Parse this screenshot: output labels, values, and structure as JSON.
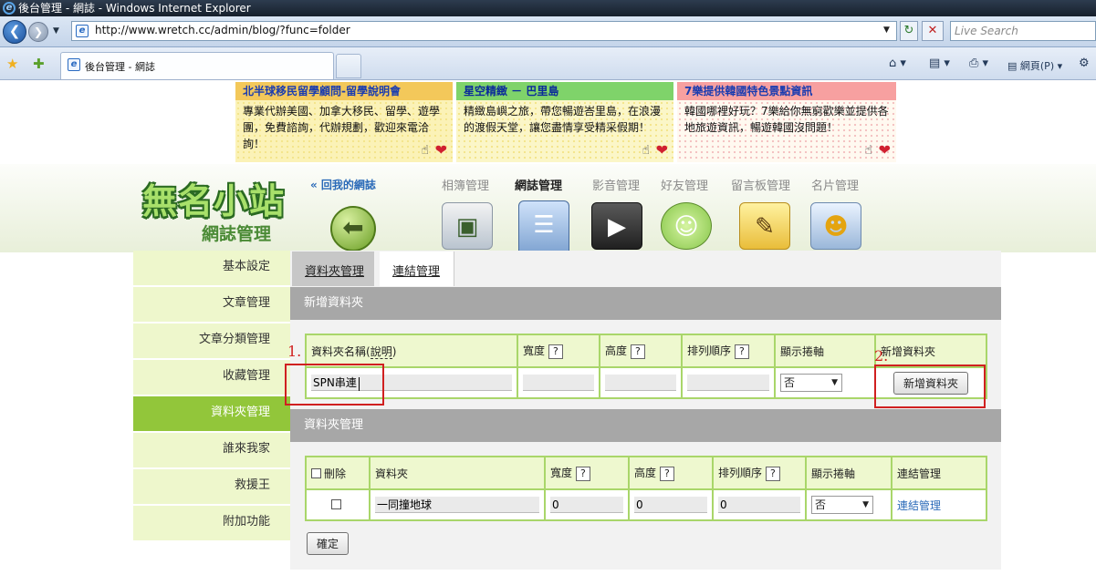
{
  "browser": {
    "window_title": "後台管理 - 網誌 - Windows Internet Explorer",
    "url": "http://www.wretch.cc/admin/blog/?func=folder",
    "search_placeholder": "Live Search",
    "tab_title": "後台管理 - 網誌",
    "page_menu": "網頁(P)"
  },
  "ads": [
    {
      "title": "北半球移民留學顧問-留學說明會",
      "body": "專業代辦美國、加拿大移民、留學、遊學團，免費諮詢，代辦規劃，歡迎來電洽詢！"
    },
    {
      "title": "星空精緻 － 巴里島",
      "body": "精緻島嶼之旅，帶您暢遊峇里島，在浪漫的渡假天堂，讓您盡情享受精采假期！"
    },
    {
      "title": "7樂提供韓國特色景點資訊",
      "body": "韓國哪裡好玩？7樂給你無窮歡樂並提供各地旅遊資訊，暢遊韓國沒問題！"
    }
  ],
  "header": {
    "logo": "無名小站",
    "subtitle": "網誌管理",
    "back_link": "« 回我的網誌",
    "nav": [
      "相簿管理",
      "網誌管理",
      "影音管理",
      "好友管理",
      "留言板管理",
      "名片管理"
    ],
    "active_nav": "網誌管理"
  },
  "sidebar": {
    "items": [
      "基本設定",
      "文章管理",
      "文章分類管理",
      "收藏管理",
      "資料夾管理",
      "誰來我家",
      "救援王",
      "附加功能"
    ],
    "active": "資料夾管理"
  },
  "subtabs": [
    "資料夾管理",
    "連結管理"
  ],
  "new_folder": {
    "section_title": "新增資料夾",
    "headers": {
      "name": "資料夾名稱(",
      "explain": "說明",
      "name_end": ")",
      "width": "寬度",
      "height": "高度",
      "order": "排列順序",
      "scroll": "顯示捲軸",
      "add": "新增資料夾"
    },
    "help_mark": "?",
    "name_value": "SPN串連",
    "scroll_value": "否",
    "add_button": "新增資料夾"
  },
  "folder_manager": {
    "section_title": "資料夾管理",
    "headers": {
      "delete": "刪除",
      "folder": "資料夾",
      "width": "寬度",
      "height": "高度",
      "order": "排列順序",
      "scroll": "顯示捲軸",
      "link": "連結管理"
    },
    "rows": [
      {
        "name": "一同撞地球",
        "width": "0",
        "height": "0",
        "order": "0",
        "scroll": "否",
        "link": "連結管理"
      }
    ],
    "confirm_button": "確定"
  },
  "annotations": {
    "mark1": "1.",
    "mark2": "2."
  },
  "colors": {
    "accent_green": "#92c63a",
    "grid_border": "#a9d66a",
    "section_gray": "#a7a7a7",
    "annotation_red": "#d02020"
  }
}
